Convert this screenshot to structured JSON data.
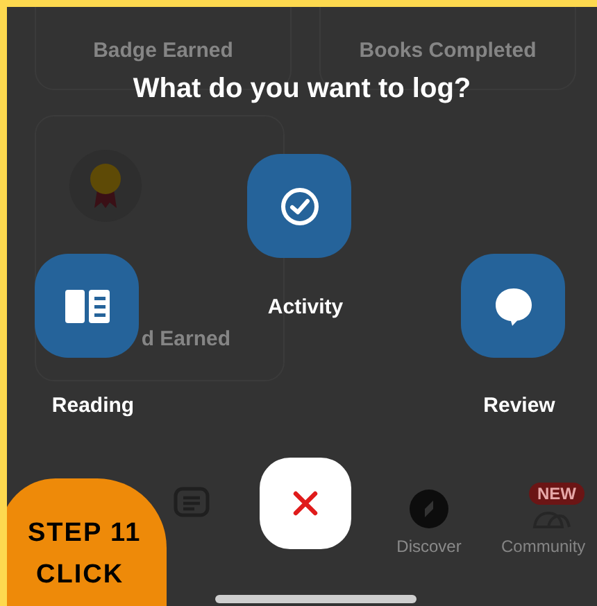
{
  "background_cards": [
    {
      "label": "Badge Earned"
    },
    {
      "label": "Books Completed"
    },
    {
      "label": "d Earned"
    }
  ],
  "prompt": "What do you want to log?",
  "log_options": [
    {
      "kind": "activity",
      "label": "Activity"
    },
    {
      "kind": "reading",
      "label": "Reading"
    },
    {
      "kind": "review",
      "label": "Review"
    }
  ],
  "tab_bar": [
    {
      "kind": "notes"
    },
    {
      "kind": "close"
    },
    {
      "kind": "discover",
      "label": "Discover"
    },
    {
      "kind": "community",
      "label": "Community",
      "badge": "NEW"
    }
  ],
  "step_callout": {
    "step": "STEP 11",
    "action": "CLICK"
  }
}
